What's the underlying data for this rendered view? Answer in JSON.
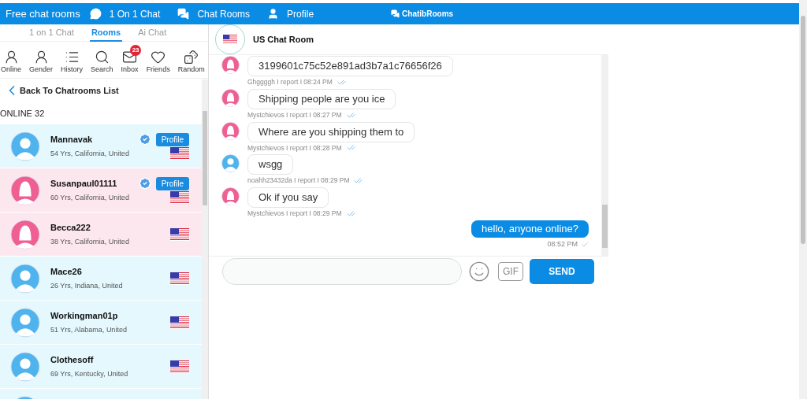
{
  "topbar": {
    "title": "Free chat rooms",
    "links": [
      {
        "label": "1 On 1 Chat",
        "kind": "chat"
      },
      {
        "label": "Chat Rooms",
        "kind": "rooms"
      },
      {
        "label": "Profile",
        "kind": "profile"
      }
    ],
    "brand": "ChatibRooms"
  },
  "tabs": [
    {
      "label": "1 on 1 Chat",
      "selected": false
    },
    {
      "label": "Rooms",
      "selected": true
    },
    {
      "label": "Ai Chat",
      "selected": false
    }
  ],
  "tools": [
    {
      "label": "Online",
      "kind": "online"
    },
    {
      "label": "Gender",
      "kind": "gender"
    },
    {
      "label": "History",
      "kind": "history"
    },
    {
      "label": "Search",
      "kind": "search"
    },
    {
      "label": "Inbox",
      "kind": "inbox",
      "badge": "23"
    },
    {
      "label": "Friends",
      "kind": "friends"
    },
    {
      "label": "Random",
      "kind": "random"
    }
  ],
  "back": "Back To Chatrooms List",
  "online_count": "ONLINE 32",
  "users": [
    {
      "name": "Mannavak",
      "info": "54 Yrs, California, United",
      "female": false,
      "verified": true,
      "profile": "Profile"
    },
    {
      "name": "Susanpaul01111",
      "info": "60 Yrs, California, United",
      "female": true,
      "verified": true,
      "profile": "Profile"
    },
    {
      "name": "Becca222",
      "info": "38 Yrs, California, United",
      "female": true,
      "verified": false
    },
    {
      "name": "Mace26",
      "info": "26 Yrs, Indiana, United",
      "female": false,
      "verified": false
    },
    {
      "name": "Workingman01p",
      "info": "51 Yrs, Alabama, United",
      "female": false,
      "verified": false
    },
    {
      "name": "Clothesoff",
      "info": "69 Yrs, Kentucky, United",
      "female": false,
      "verified": false
    },
    {
      "female": false
    }
  ],
  "room": {
    "title": "US Chat Room"
  },
  "messages": [
    {
      "own": false,
      "female": true,
      "text": "3199601c75c52e891ad3b7a1c76656f26",
      "meta": "Ghggggh I report I 08:24 PM"
    },
    {
      "own": false,
      "female": true,
      "text": "Shipping people are you ice",
      "meta": "Mystchievos I report I 08:27 PM"
    },
    {
      "own": false,
      "female": true,
      "text": "Where are you shipping them to",
      "meta": "Mystchievos I report I 08:28 PM"
    },
    {
      "own": false,
      "female": false,
      "text": "wsgg",
      "meta": "noahh23432da I report I 08:29 PM"
    },
    {
      "own": false,
      "female": true,
      "text": "Ok if you say",
      "meta": "Mystchievos I report I 08:29 PM"
    },
    {
      "own": true,
      "text": "hello, anyone online?",
      "meta": "08:52 PM"
    }
  ],
  "composer": {
    "gif": "GIF",
    "send": "SEND"
  }
}
